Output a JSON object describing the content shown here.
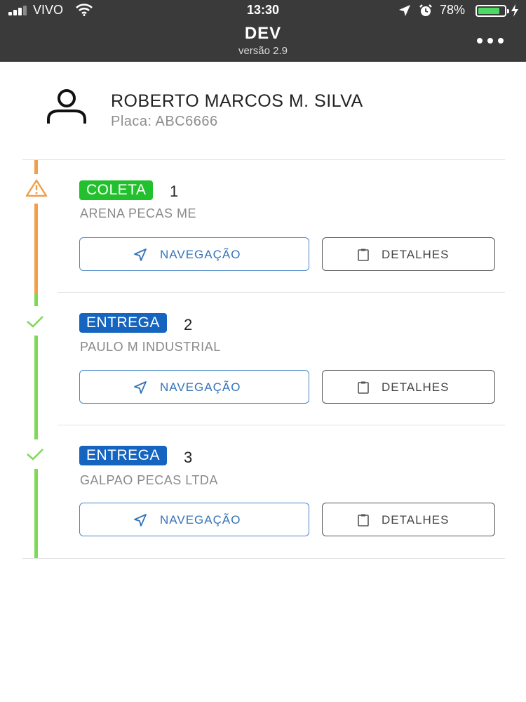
{
  "status_bar": {
    "carrier": "VIVO",
    "time": "13:30",
    "battery_percent": "78%",
    "battery_level": 0.78,
    "signal_bars": 3
  },
  "nav": {
    "title": "DEV",
    "subtitle": "versão 2.9",
    "menu_icon": "more-dots-icon"
  },
  "driver": {
    "name": "ROBERTO MARCOS M. SILVA",
    "plate": "Placa: ABC6666",
    "icon": "user-icon"
  },
  "colors": {
    "collect": "#22c02c",
    "deliver": "#1565c0",
    "pending_line": "#f0a04b",
    "done_line": "#7ed957",
    "nav_button": "#3473b8"
  },
  "stops": [
    {
      "type_label": "COLETA",
      "type_color": "green",
      "number": "1",
      "company": "ARENA PECAS ME",
      "status_icon": "warning-icon",
      "nav_label": "NAVEGAÇÃO",
      "details_label": "DETALHES"
    },
    {
      "type_label": "ENTREGA",
      "type_color": "blue",
      "number": "2",
      "company": "PAULO M INDUSTRIAL",
      "status_icon": "check-icon",
      "nav_label": "NAVEGAÇÃO",
      "details_label": "DETALHES"
    },
    {
      "type_label": "ENTREGA",
      "type_color": "blue",
      "number": "3",
      "company": "GALPAO PECAS LTDA",
      "status_icon": "check-icon",
      "nav_label": "NAVEGAÇÃO",
      "details_label": "DETALHES"
    }
  ]
}
